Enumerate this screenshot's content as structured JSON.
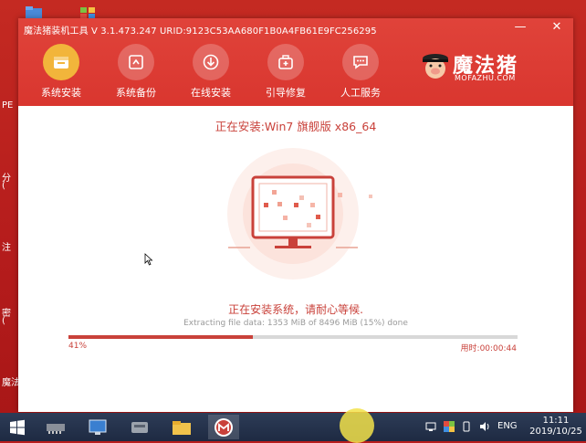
{
  "window": {
    "title": "魔法猪装机工具 V 3.1.473.247 URID:9123C53AA680F1B0A4FB61E9FC256295",
    "minimize": "—",
    "close": "✕"
  },
  "nav": {
    "items": [
      {
        "label": "系统安装",
        "icon": "install-icon",
        "active": true
      },
      {
        "label": "系统备份",
        "icon": "backup-icon",
        "active": false
      },
      {
        "label": "在线安装",
        "icon": "download-icon",
        "active": false
      },
      {
        "label": "引导修复",
        "icon": "toolbox-icon",
        "active": false
      },
      {
        "label": "人工服务",
        "icon": "chat-icon",
        "active": false
      }
    ]
  },
  "logo": {
    "main": "魔法猪",
    "sub": "MOFAZHU.COM"
  },
  "install": {
    "title": "正在安装:Win7 旗舰版 x86_64",
    "status": "正在安装系统，请耐心等候.",
    "extract": "Extracting file data: 1353 MiB of 8496 MiB (15%) done",
    "progress_percent": 41,
    "progress_label": "41%",
    "elapsed": "用时:00:00:44"
  },
  "desktop": {
    "labels": [
      "PE",
      "分",
      "(",
      "注",
      "密",
      "(",
      "魔法"
    ]
  },
  "taskbar": {
    "lang": "ENG",
    "time": "11:11",
    "date": "2019/10/25"
  },
  "colors": {
    "brand_red": "#d9362f",
    "accent_orange": "#f2b53b",
    "progress_red": "#c9413a"
  }
}
